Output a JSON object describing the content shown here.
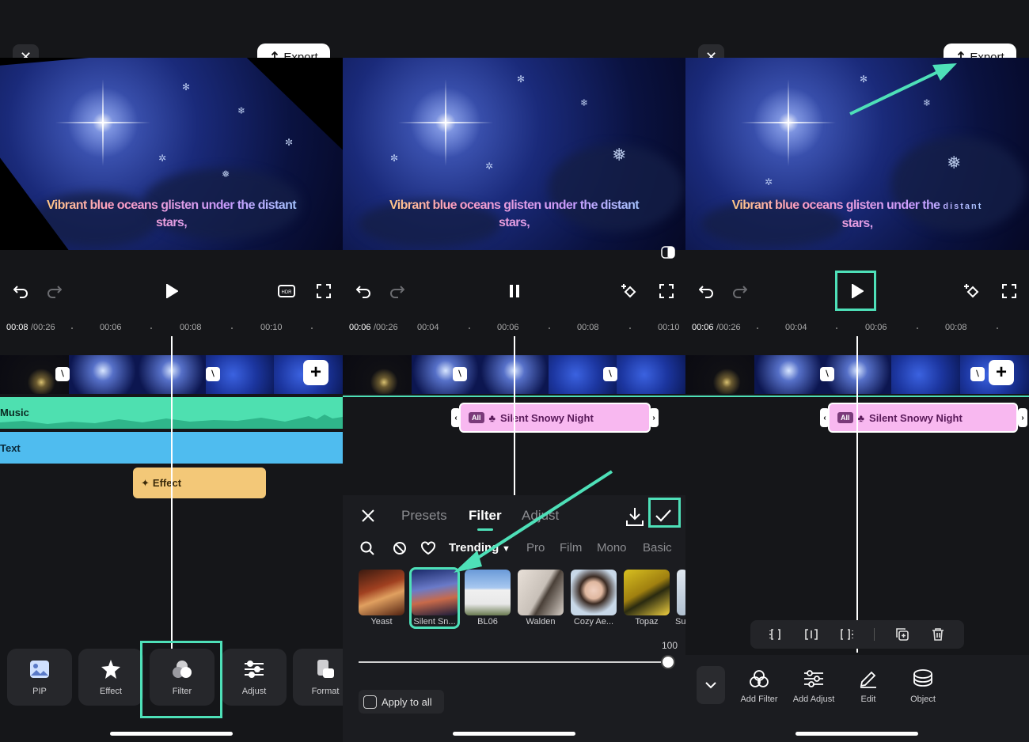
{
  "colors": {
    "accent": "#4ee0b8",
    "music": "#4ee0b0",
    "text_track": "#4fbcef",
    "effect_clip": "#f3c878",
    "filter_clip": "#f8b8f0"
  },
  "preview": {
    "caption_line1": "Vibrant blue oceans glisten under the distant",
    "caption_line2": "stars,"
  },
  "panel3_caption": {
    "line1": "Vibrant blue oceans glisten under the",
    "line1_tail": "distant",
    "line2": "stars,"
  },
  "top": {
    "export_label": "Export"
  },
  "panel1": {
    "ruler": {
      "current": "00:08",
      "total": "/00:26",
      "ticks": [
        "00:06",
        "00:08",
        "00:10"
      ]
    },
    "tracks": {
      "music": "Music",
      "text": "Text",
      "effect": "Effect"
    },
    "tools": [
      {
        "label": "PIP",
        "icon": "image-icon"
      },
      {
        "label": "Effect",
        "icon": "sparkle-icon"
      },
      {
        "label": "Filter",
        "icon": "filter-icon"
      },
      {
        "label": "Adjust",
        "icon": "sliders-icon"
      },
      {
        "label": "Format",
        "icon": "format-icon"
      }
    ]
  },
  "panel2": {
    "ruler": {
      "current": "00:06",
      "total": "/00:26",
      "ticks": [
        "00:04",
        "00:06",
        "00:08",
        "00:10"
      ]
    },
    "filter_clip": {
      "badge": "All",
      "name": "Silent Snowy Night"
    },
    "sheet": {
      "tabs": [
        "Presets",
        "Filter",
        "Adjust"
      ],
      "active_tab": "Filter",
      "categories": [
        "Trending",
        "Pro",
        "Film",
        "Mono",
        "Basic"
      ],
      "filters": [
        "Yeast",
        "Silent Sn...",
        "BL06",
        "Walden",
        "Cozy Ae...",
        "Topaz",
        "Su"
      ],
      "selected_filter": "Silent Sn...",
      "intensity": "100",
      "apply_all": "Apply to all"
    }
  },
  "panel3": {
    "ruler": {
      "current": "00:06",
      "total": "/00:26",
      "ticks": [
        "00:04",
        "00:06",
        "00:08"
      ]
    },
    "filter_clip": {
      "badge": "All",
      "name": "Silent Snowy Night"
    },
    "bottom_tools": [
      "Add Filter",
      "Add Adjust",
      "Edit",
      "Object"
    ]
  }
}
